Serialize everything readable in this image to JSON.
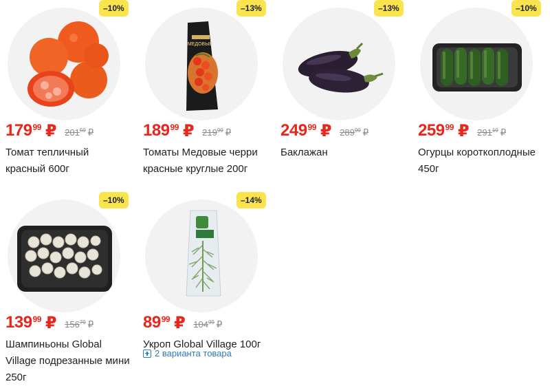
{
  "products": [
    {
      "title": "Томат тепличный красный 600г",
      "price_rub": "179",
      "price_kop": "99",
      "old_rub": "201",
      "old_kop": "59",
      "discount": "–10%",
      "image": "tomatoes"
    },
    {
      "title": "Томаты Медовые черри красные круглые 200г",
      "price_rub": "189",
      "price_kop": "99",
      "old_rub": "219",
      "old_kop": "99",
      "discount": "–13%",
      "image": "cherry-tomatoes-pack",
      "pack_text": "МЕДОВЫЕ"
    },
    {
      "title": "Баклажан",
      "price_rub": "249",
      "price_kop": "99",
      "old_rub": "289",
      "old_kop": "99",
      "discount": "–13%",
      "image": "eggplants"
    },
    {
      "title": "Огурцы короткоплодные 450г",
      "price_rub": "259",
      "price_kop": "99",
      "old_rub": "291",
      "old_kop": "19",
      "discount": "–10%",
      "image": "cucumbers-tray"
    },
    {
      "title": "Шампиньоны Global Village подрезанные мини 250г",
      "price_rub": "139",
      "price_kop": "99",
      "old_rub": "156",
      "old_kop": "79",
      "discount": "–10%",
      "image": "mushrooms-tray"
    },
    {
      "title": "Укроп Global Village 100г",
      "price_rub": "89",
      "price_kop": "99",
      "old_rub": "104",
      "old_kop": "99",
      "discount": "–14%",
      "image": "dill-pack",
      "variants": "2 варианта товара"
    }
  ],
  "currency": "₽",
  "colors": {
    "price": "#e8261d",
    "badge": "#f9e44d",
    "link": "#2a7bc0",
    "old_price": "#8a8a8a"
  }
}
